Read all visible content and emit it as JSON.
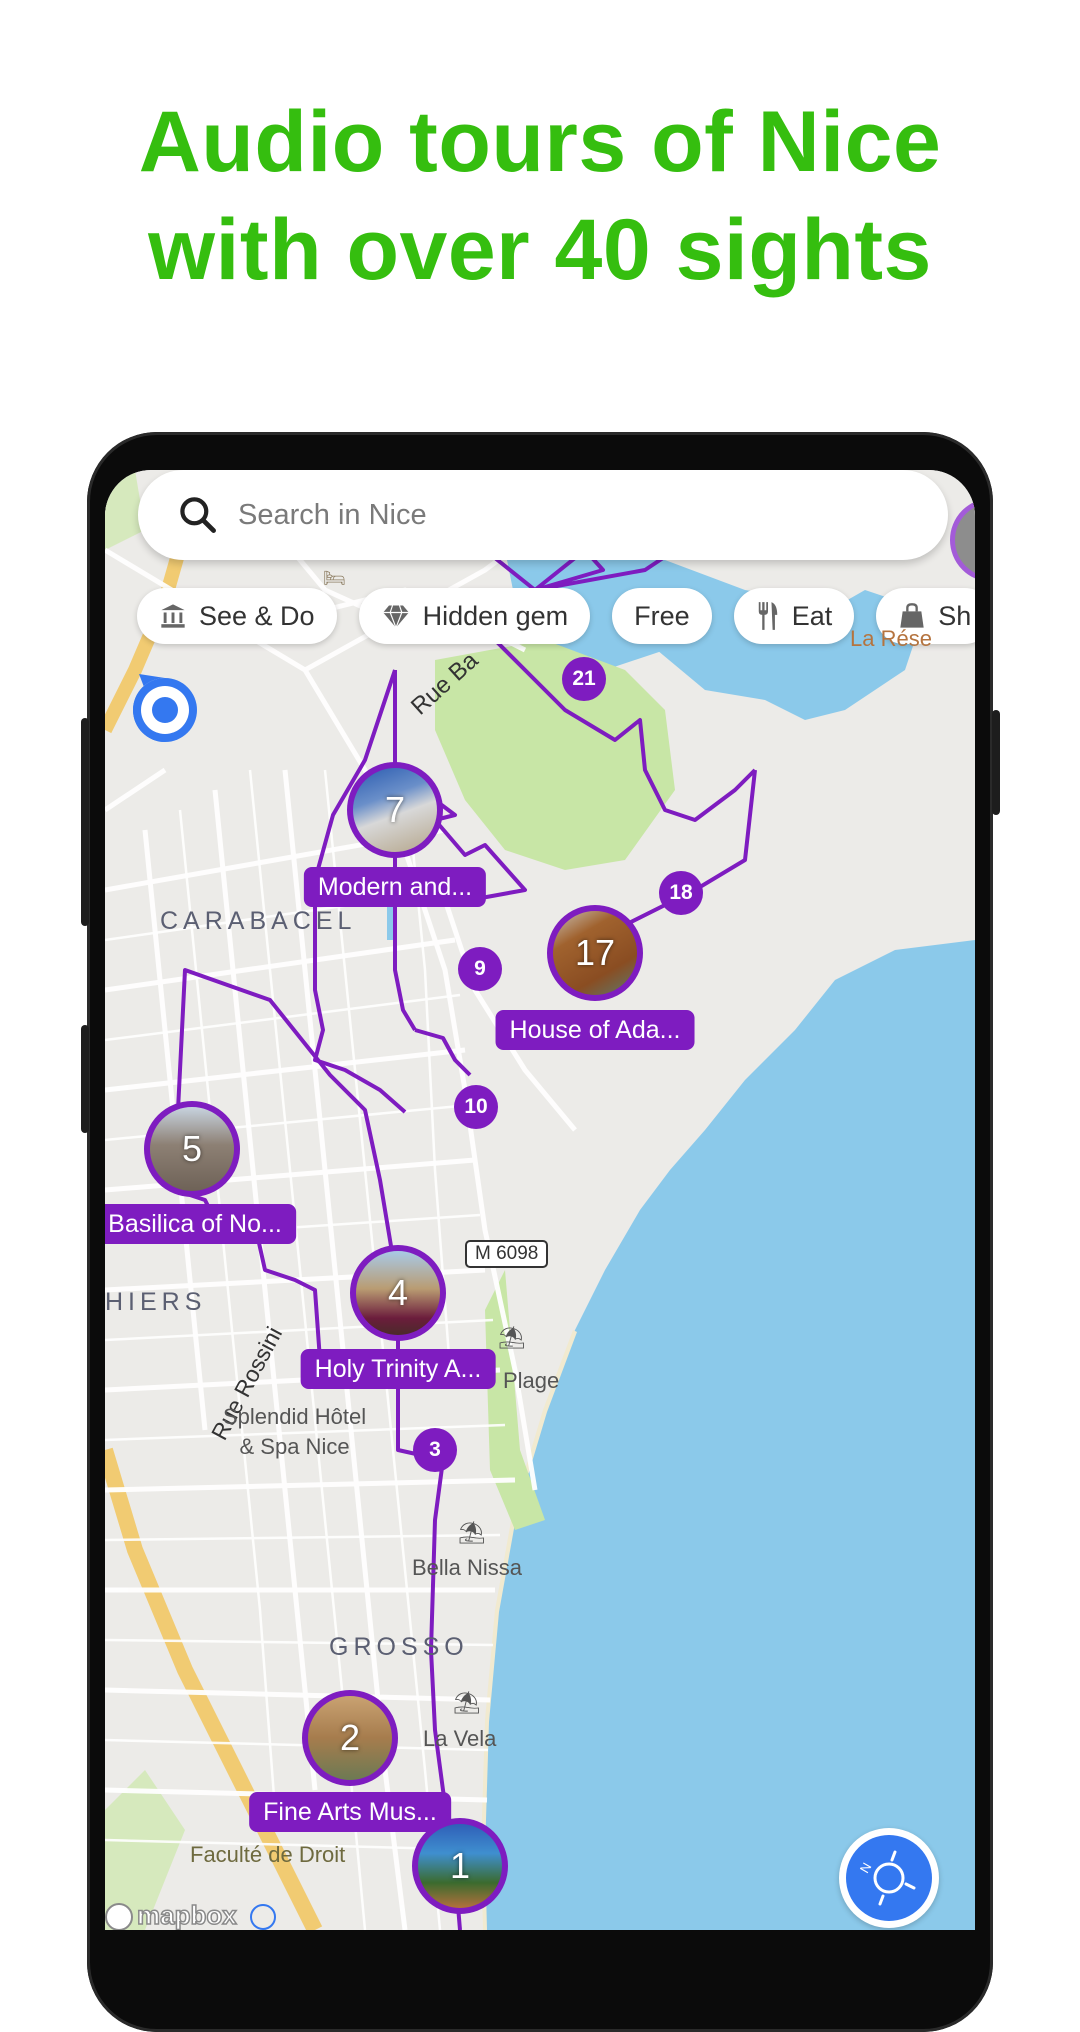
{
  "headline": {
    "line1": "Audio tours of Nice",
    "line2": "with over 40 sights",
    "color": "#35be0f"
  },
  "search": {
    "placeholder": "Search in Nice",
    "icon": "search-icon"
  },
  "chips": [
    {
      "label": "See & Do",
      "icon": "museum-icon"
    },
    {
      "label": "Hidden gem",
      "icon": "diamond-icon"
    },
    {
      "label": "Free",
      "icon": ""
    },
    {
      "label": "Eat",
      "icon": "fork-knife-icon"
    },
    {
      "label": "Sh",
      "icon": "shopping-bag-icon"
    }
  ],
  "markers": {
    "photo": [
      {
        "number": "7",
        "label": "Modern and..."
      },
      {
        "number": "17",
        "label": "House of Ada..."
      },
      {
        "number": "5",
        "label": "Basilica of No..."
      },
      {
        "number": "4",
        "label": "Holy Trinity A..."
      },
      {
        "number": "2",
        "label": "Fine Arts Mus..."
      },
      {
        "number": "1",
        "label": ""
      }
    ],
    "numbered": [
      "21",
      "18",
      "9",
      "10",
      "3"
    ]
  },
  "map_labels": {
    "street_rue_ba": "Rue Ba",
    "district_carabacel": "CARABACEL",
    "district_thiers": "HIERS",
    "street_rossini": "Rue Rossini",
    "hotel_line1": "Splendid Hôtel",
    "hotel_line2": "& Spa Nice",
    "plage": "Plage",
    "bella_nissa": "Bella Nissa",
    "district_grosso": "GROSSO",
    "la_vela": "La Vela",
    "faculte": "Faculté de Droit",
    "la_reserve": "La Rése",
    "road_tag": "M 6098",
    "attribution": "mapbox"
  },
  "colors": {
    "route": "#7e1cc0",
    "sea": "#8bc9ea",
    "land": "#ecebe8",
    "park": "#c8e6a6",
    "compass": "#3478f0"
  }
}
